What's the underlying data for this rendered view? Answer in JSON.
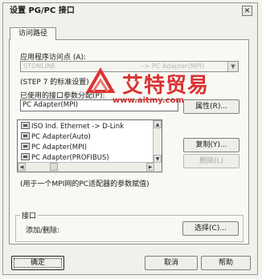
{
  "window": {
    "title": "设置 PG/PC 接口",
    "close_glyph": "✕"
  },
  "tabs": [
    {
      "label": "访问路径",
      "active": true
    }
  ],
  "access_point": {
    "label": "应用程序访问点 (A):",
    "value": "STONLINE",
    "value_suffix": "--> PC Adapter(MPI)",
    "note": "(STEP 7 的标准设置)"
  },
  "interface": {
    "label": "已使用的接口参数分配(P):",
    "value": "PC Adapter(MPI)",
    "properties_button": "属性(R)..."
  },
  "interface_list": {
    "items": [
      "ISO Ind. Ethernet -> D-Link",
      "PC Adapter(Auto)",
      "PC Adapter(MPI)",
      "PC Adapter(PROFIBUS)"
    ]
  },
  "buttons": {
    "copy": "复制(Y)...",
    "delete": "删除(L)",
    "select": "选择(C)...",
    "ok": "确定",
    "cancel": "取消",
    "help": "帮助"
  },
  "description": "(用于一个MPI网的PC适配器的参数赋值)",
  "interfaces_group": {
    "title": "接口",
    "add_remove_label": "添加/删除:"
  },
  "watermark": {
    "text": "艾特贸易",
    "url": "www.aitmy.com"
  }
}
